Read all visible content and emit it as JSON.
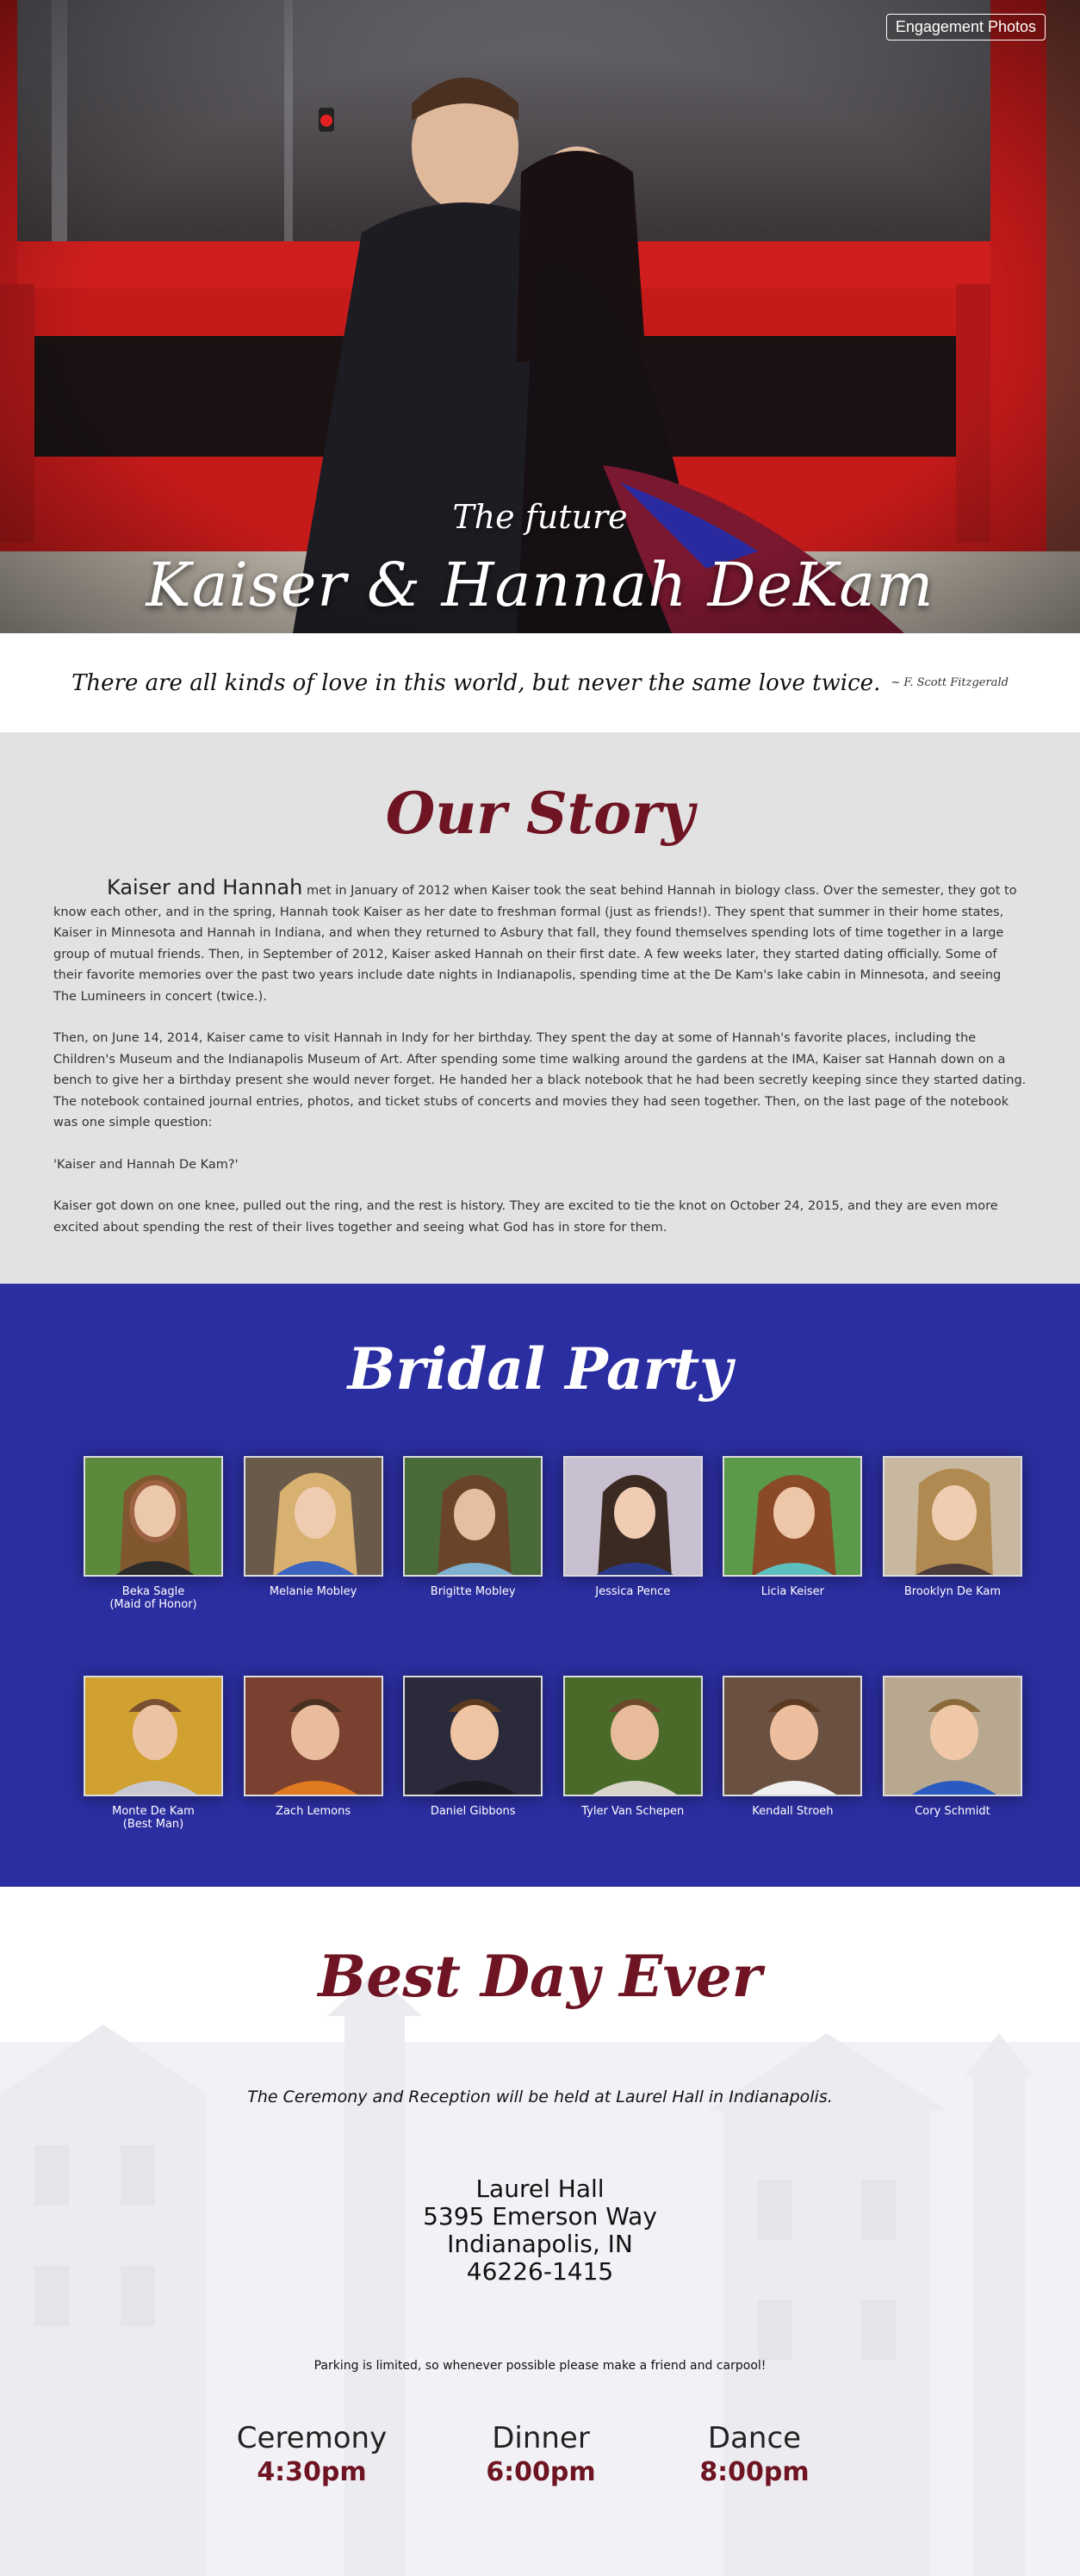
{
  "hero": {
    "engagement_button": "Engagement Photos",
    "subtitle": "The future",
    "names": "Kaiser & Hannah DeKam"
  },
  "quote": {
    "text": "There are all kinds of love in this world, but never the same love twice.",
    "author": "~ F. Scott Fitzgerald"
  },
  "story": {
    "title": "Our Story",
    "lead": "Kaiser and Hannah",
    "p1": "met in January of 2012 when Kaiser took the seat behind Hannah in biology class. Over the semester, they got to know each other, and in the spring, Hannah took Kaiser as her date to freshman formal (just as friends!). They spent that summer in their home states, Kaiser in Minnesota and Hannah in Indiana, and when they returned to Asbury that fall, they found themselves spending lots of time together in a large group of mutual friends. Then, in September of 2012, Kaiser asked Hannah on their first date. A few weeks later, they started dating officially. Some of their favorite memories over the past two years include date nights in Indianapolis, spending time at the De Kam's lake cabin in Minnesota, and seeing The Lumineers in concert (twice.).",
    "p2": "Then, on June 14, 2014, Kaiser came to visit Hannah in Indy for her birthday. They spent the day at some of Hannah's favorite places, including the Children's Museum and the Indianapolis Museum of Art. After spending some time walking around the gardens at the IMA, Kaiser sat Hannah down on a bench to give her a birthday present she would never forget. He handed her a black notebook that he had been secretly keeping since they started dating. The notebook contained journal entries, photos, and ticket stubs of concerts and movies they had seen together. Then, on the last page of the notebook was one simple question:",
    "p3": "'Kaiser and Hannah De Kam?'",
    "p4": "Kaiser got down on one knee, pulled out the ring, and the rest is history. They are excited to tie the knot on October 24, 2015, and they are even more excited about spending the rest of their lives together and seeing what God has in store for them."
  },
  "party": {
    "title": "Bridal Party",
    "bridesmaids": [
      {
        "name": "Beka Sagle",
        "role": "(Maid of Honor)"
      },
      {
        "name": "Melanie Mobley",
        "role": ""
      },
      {
        "name": "Brigitte Mobley",
        "role": ""
      },
      {
        "name": "Jessica Pence",
        "role": ""
      },
      {
        "name": "Licia Keiser",
        "role": ""
      },
      {
        "name": "Brooklyn De Kam",
        "role": ""
      }
    ],
    "groomsmen": [
      {
        "name": "Monte De Kam",
        "role": "(Best Man)"
      },
      {
        "name": "Zach Lemons",
        "role": ""
      },
      {
        "name": "Daniel Gibbons",
        "role": ""
      },
      {
        "name": "Tyler Van Schepen",
        "role": ""
      },
      {
        "name": "Kendall Stroeh",
        "role": ""
      },
      {
        "name": "Cory Schmidt",
        "role": ""
      }
    ]
  },
  "bestday": {
    "title": "Best Day Ever",
    "venue_line": "The Ceremony and Reception will be held at Laurel Hall in Indianapolis.",
    "address": {
      "line1": "Laurel Hall",
      "line2": "5395 Emerson Way",
      "line3": "Indianapolis, IN",
      "line4": "46226-1415"
    },
    "parking": "Parking is limited, so whenever possible please make a friend and carpool!",
    "schedule": [
      {
        "label": "Ceremony",
        "time": "4:30pm"
      },
      {
        "label": "Dinner",
        "time": "6:00pm"
      },
      {
        "label": "Dance",
        "time": "8:00pm"
      }
    ]
  },
  "colors": {
    "accent": "#6e1423",
    "party_bg": "#2b2ea0",
    "story_bg": "#e2e2e2"
  }
}
